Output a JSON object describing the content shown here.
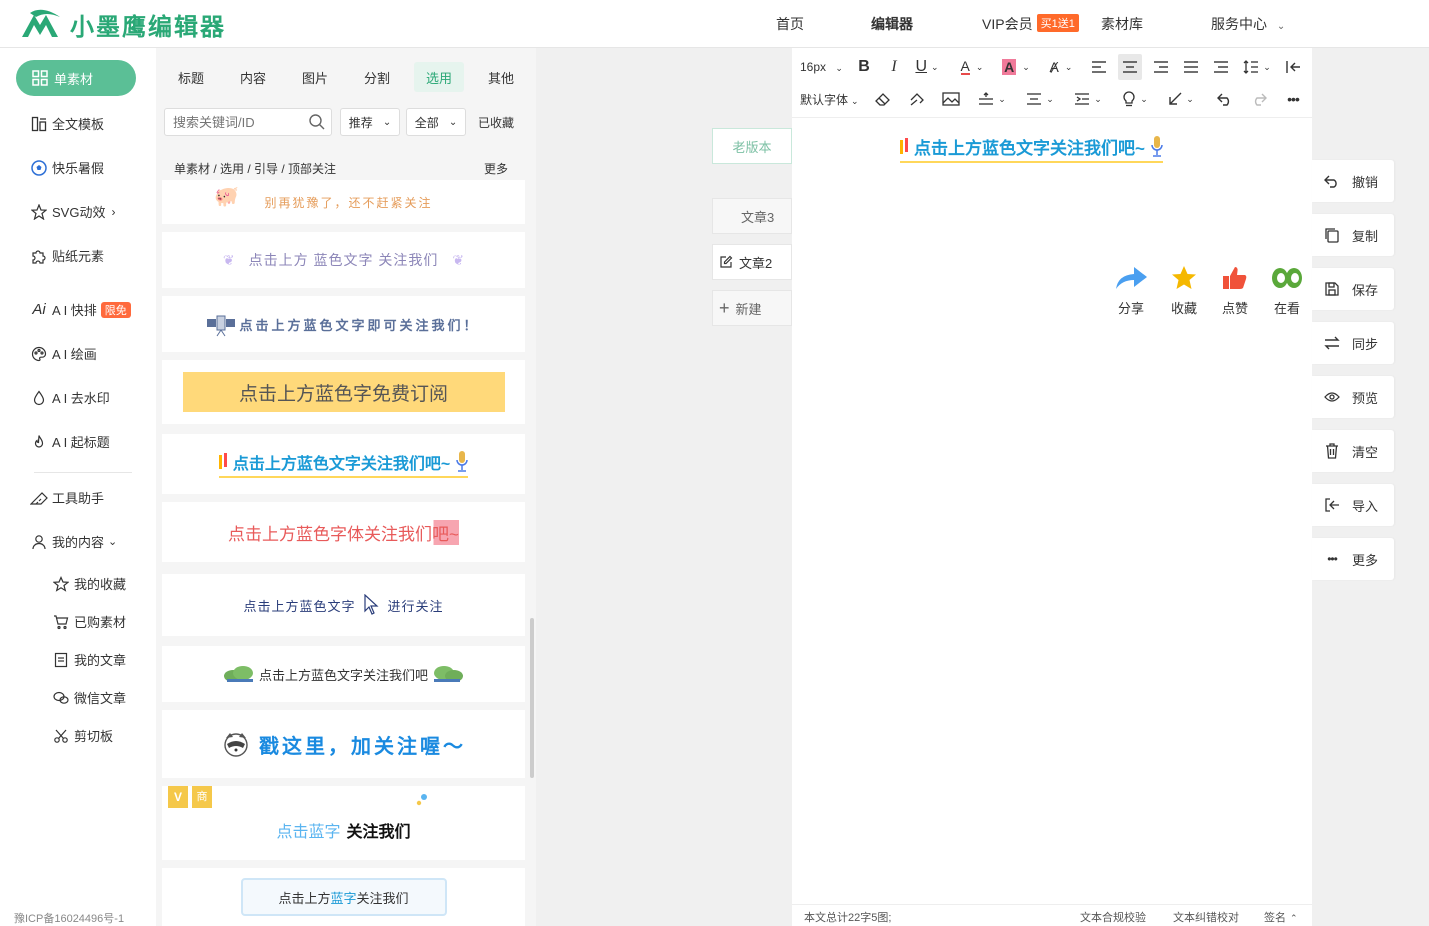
{
  "header": {
    "logo_text": "小墨鹰编辑器",
    "nav": {
      "home": "首页",
      "editor": "编辑器",
      "vip": "VIP会员",
      "vip_badge": "买1送1",
      "library": "素材库",
      "service": "服务中心"
    }
  },
  "sidebar": {
    "items": [
      {
        "label": "单素材",
        "icon": "grid-icon"
      },
      {
        "label": "全文模板",
        "icon": "template-icon"
      },
      {
        "label": "快乐暑假",
        "icon": "soccer-ball-icon"
      },
      {
        "label": "SVG动效",
        "icon": "star-icon"
      },
      {
        "label": "贴纸元素",
        "icon": "puzzle-icon"
      },
      {
        "label": "A I 快排",
        "icon": "ai-icon",
        "badge": "限免"
      },
      {
        "label": "A I 绘画",
        "icon": "palette-icon"
      },
      {
        "label": "A I 去水印",
        "icon": "water-drop-icon"
      },
      {
        "label": "A I 起标题",
        "icon": "flame-icon"
      },
      {
        "label": "工具助手",
        "icon": "ruler-icon"
      },
      {
        "label": "我的内容",
        "icon": "user-icon"
      }
    ],
    "sub_items": [
      {
        "label": "我的收藏",
        "icon": "star-outline-icon"
      },
      {
        "label": "已购素材",
        "icon": "cart-icon"
      },
      {
        "label": "我的文章",
        "icon": "document-icon"
      },
      {
        "label": "微信文章",
        "icon": "wechat-icon"
      },
      {
        "label": "剪切板",
        "icon": "scissors-icon"
      }
    ],
    "icp": "豫ICP备16024496号-1"
  },
  "panel": {
    "tabs": [
      "标题",
      "内容",
      "图片",
      "分割",
      "选用",
      "其他"
    ],
    "active_tab": "选用",
    "search_placeholder": "搜索关键词/ID",
    "filter_sort": "推荐",
    "filter_scope": "全部",
    "favorites": "已收藏",
    "breadcrumb": "单素材 / 选用 / 引导 / 顶部关注",
    "more": "更多",
    "cards": [
      {
        "text": "别再犹豫了，还不赶紧关注"
      },
      {
        "text": "点击上方 蓝色文字 关注我们"
      },
      {
        "text": "点击上方蓝色文字即可关注我们！"
      },
      {
        "text": "点击上方蓝色字免费订阅"
      },
      {
        "text": "点击上方蓝色文字关注我们吧~"
      },
      {
        "text": "点击上方蓝色字体关注我们吧~"
      },
      {
        "text": "点击上方蓝色文字",
        "text2": "进行关注"
      },
      {
        "text": "点击上方蓝色文字关注我们吧"
      },
      {
        "text": "戳这里，加关注喔～"
      },
      {
        "text": "点击蓝字",
        "text2": "关注我们",
        "badge1": "V",
        "badge2": "商"
      },
      {
        "text": "点击上方",
        "text2": "蓝字",
        "text3": "关注我们"
      }
    ]
  },
  "versions": {
    "old": "老版本",
    "article3": "文章3",
    "article2": "文章2",
    "new": "新建"
  },
  "editor": {
    "font_size": "16px",
    "font_family": "默认字体",
    "content_title": "点击上方蓝色文字关注我们吧~",
    "reactions": [
      "分享",
      "收藏",
      "点赞",
      "在看"
    ],
    "status_count": "本文总计22字5图;",
    "status_check": "文本合规校验",
    "status_proof": "文本纠错校对",
    "status_sign": "签名"
  },
  "actions": [
    {
      "label": "撤销",
      "icon": "undo-icon"
    },
    {
      "label": "复制",
      "icon": "copy-icon"
    },
    {
      "label": "保存",
      "icon": "save-icon"
    },
    {
      "label": "同步",
      "icon": "sync-icon"
    },
    {
      "label": "预览",
      "icon": "eye-icon"
    },
    {
      "label": "清空",
      "icon": "trash-icon"
    },
    {
      "label": "导入",
      "icon": "import-icon"
    },
    {
      "label": "更多",
      "icon": "more-icon"
    }
  ],
  "colors": {
    "brand_green": "#2aa876",
    "pill_green": "#5bbf96",
    "title_blue": "#1a9ad6",
    "card_yellow": "#ffd97a",
    "badge_orange": "#ff6a2a"
  }
}
